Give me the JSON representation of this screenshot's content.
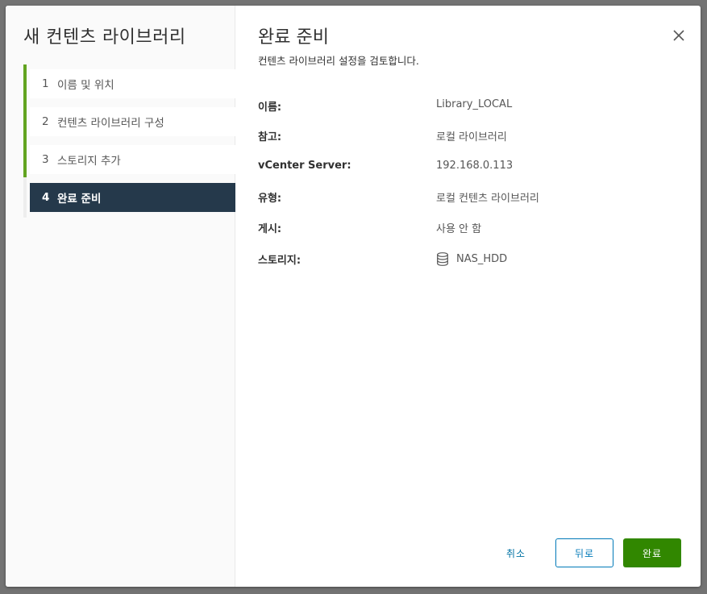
{
  "sidebar": {
    "title": "새 컨텐츠 라이브러리",
    "steps": [
      {
        "num": "1",
        "label": "이름 및 위치"
      },
      {
        "num": "2",
        "label": "컨텐츠 라이브러리 구성"
      },
      {
        "num": "3",
        "label": "스토리지 추가"
      },
      {
        "num": "4",
        "label": "완료 준비"
      }
    ]
  },
  "main": {
    "title": "완료 준비",
    "subtitle": "컨텐츠 라이브러리 설정을 검토합니다.",
    "summary": [
      {
        "label": "이름:",
        "value": "Library_LOCAL"
      },
      {
        "label": "참고:",
        "value": "로컬 라이브러리"
      },
      {
        "label": "vCenter Server:",
        "value": "192.168.0.113"
      },
      {
        "label": "유형:",
        "value": "로컬 컨텐츠 라이브러리"
      },
      {
        "label": "게시:",
        "value": "사용 안 함"
      },
      {
        "label": "스토리지:",
        "value": "NAS_HDD",
        "icon": "datastore-icon"
      }
    ]
  },
  "footer": {
    "cancel_label": "취소",
    "back_label": "뒤로",
    "finish_label": "완료"
  },
  "colors": {
    "progress": "#62a420",
    "active_step": "#25394b",
    "primary_button": "#318700",
    "link": "#0079b8"
  }
}
